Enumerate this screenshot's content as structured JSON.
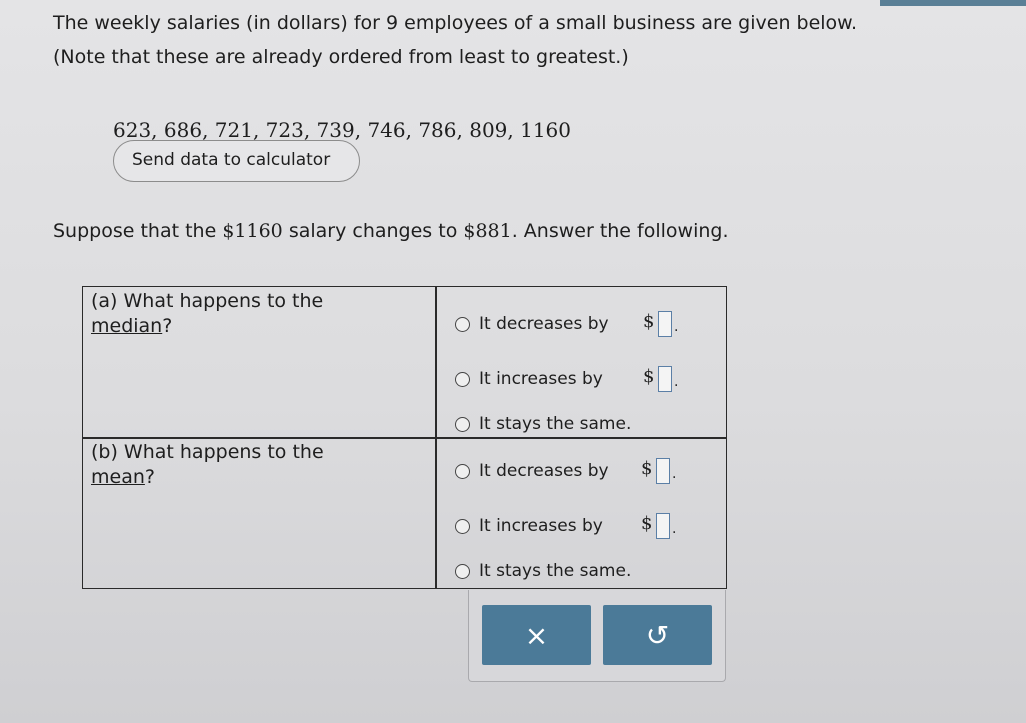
{
  "intro": {
    "line1": "The weekly salaries (in dollars) for 9 employees of a small business are given below.",
    "line2": "(Note that these are already ordered from least to greatest.)"
  },
  "data_values": "623, 686, 721, 723, 739, 746, 786, 809, 1160",
  "send_button_label": "Send data to calculator",
  "change_statement": {
    "before": "Suppose that the ",
    "old_amount": "$1160",
    "middle": " salary changes to ",
    "new_amount": "$881",
    "after": ". Answer the following."
  },
  "part_a": {
    "label_prefix": "(a)  What happens to the",
    "label_term": "median",
    "label_suffix": "?",
    "options": [
      "It decreases by",
      "It increases by",
      "It stays the same."
    ]
  },
  "part_b": {
    "label_prefix": "(b)  What happens to the",
    "label_term": "mean",
    "label_suffix": "?",
    "options": [
      "It decreases by",
      "It increases by",
      "It stays the same."
    ]
  },
  "currency_symbol": "$",
  "period": ".",
  "actions": {
    "clear_icon": "×",
    "undo_icon": "↺"
  },
  "colors": {
    "action_button": "#4b7a98",
    "answer_box_border": "#5b7fa6"
  }
}
